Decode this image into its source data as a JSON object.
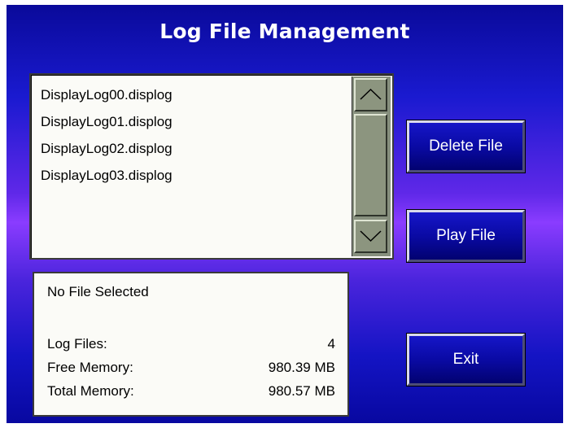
{
  "title": "Log File Management",
  "files": [
    "DisplayLog00.displog",
    "DisplayLog01.displog",
    "DisplayLog02.displog",
    "DisplayLog03.displog"
  ],
  "scrollbar": {
    "up_icon": "chevron-up-icon",
    "down_icon": "chevron-down-icon"
  },
  "buttons": {
    "delete": "Delete File",
    "play": "Play File",
    "exit": "Exit"
  },
  "info": {
    "selected": "No File Selected",
    "log_files_label": "Log Files:",
    "log_files_value": "4",
    "free_memory_label": "Free Memory:",
    "free_memory_value": "980.39 MB",
    "total_memory_label": "Total Memory:",
    "total_memory_value": "980.57 MB"
  },
  "colors": {
    "background_top": "#0a0a9a",
    "background_mid": "#8a3cff",
    "button": "#0a0aa4",
    "scrollbar": "#87907e",
    "panel": "#fbfbf7"
  }
}
